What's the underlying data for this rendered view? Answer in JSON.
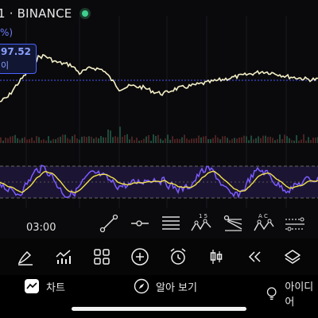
{
  "header": {
    "symbol": "1 · BINANCE",
    "change_pct": "%)",
    "price": "97.52",
    "price_sub": "이"
  },
  "chart_data": {
    "type": "line",
    "panels": [
      "price",
      "volume",
      "oscillator"
    ],
    "price_series_color": "#f5f0c8",
    "oscillator_colors": {
      "main": "#7b5cff",
      "signal": "#f2e24a"
    },
    "dotted_level_color": "#4b56ff"
  },
  "time_axis": {
    "label": "03:00"
  },
  "drawing_toolbar": {
    "tools": [
      "trend-line-icon",
      "horizontal-ray-icon",
      "fib-retracement-icon",
      "abcd-pattern-icon",
      "fib-fan-icon",
      "abc-pattern-icon",
      "parallel-channel-icon"
    ],
    "labels": {
      "pattern_nums": "1  5",
      "pattern_letters": "A  C"
    }
  },
  "main_toolbar": {
    "items": [
      "brush-icon",
      "indicators-icon",
      "grid-icon",
      "add-icon",
      "alarm-icon",
      "candles-icon",
      "replay-icon",
      "layers-icon"
    ]
  },
  "tabs": {
    "chart": "차트",
    "explore": "알아 보기",
    "ideas": "아이디어"
  },
  "colors": {
    "accent": "#4b63ff",
    "status_green": "#3fcf8e"
  }
}
